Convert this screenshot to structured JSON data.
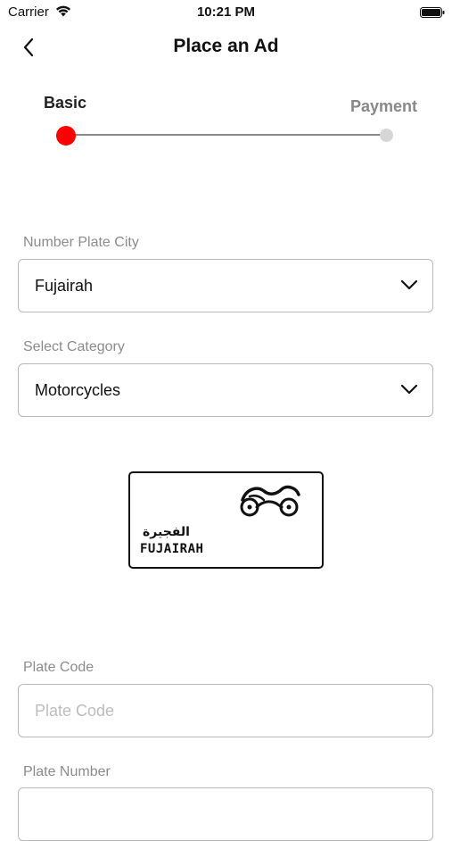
{
  "status_bar": {
    "carrier": "Carrier",
    "time": "10:21 PM"
  },
  "header": {
    "title": "Place an Ad",
    "back_icon": "chevron-left-icon"
  },
  "stepper": {
    "steps": [
      {
        "label": "Basic",
        "state": "active"
      },
      {
        "label": "Payment",
        "state": "inactive"
      }
    ],
    "active_color": "#ff0000",
    "inactive_color": "#d6d6d6"
  },
  "form": {
    "plate_city": {
      "label": "Number Plate City",
      "value": "Fujairah"
    },
    "category": {
      "label": "Select Category",
      "value": "Motorcycles"
    },
    "plate_preview": {
      "arabic_text": "الفجيرة",
      "city_text": "FUJAIRAH",
      "icon": "motorcycle-icon"
    },
    "plate_code": {
      "label": "Plate Code",
      "placeholder": "Plate Code",
      "value": ""
    },
    "plate_number": {
      "label": "Plate Number"
    }
  }
}
